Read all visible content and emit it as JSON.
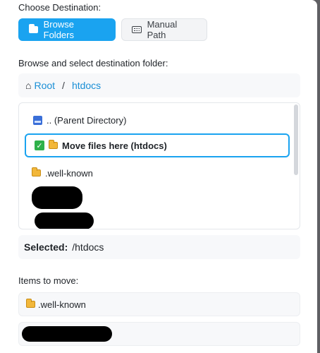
{
  "destination": {
    "label": "Choose Destination:",
    "browse_button": "Browse Folders",
    "manual_button": "Manual Path"
  },
  "browse": {
    "label": "Browse and select destination folder:",
    "breadcrumb": [
      "Root",
      "/",
      "htdocs"
    ]
  },
  "folder_list": {
    "parent": ".. (Parent Directory)",
    "target": "Move files here (htdocs)",
    "items": [
      ".well-known"
    ]
  },
  "selected": {
    "label": "Selected:",
    "value": "/htdocs"
  },
  "move": {
    "label": "Items to move:",
    "items": [
      ".well-known"
    ]
  },
  "colors": {
    "accent": "#1aa3f0",
    "link": "#1a8fd6",
    "folder": "#f2b73a"
  },
  "icons": [
    "folder-icon",
    "keyboard-icon",
    "home-icon",
    "parent-directory-icon",
    "checkmark-icon"
  ]
}
